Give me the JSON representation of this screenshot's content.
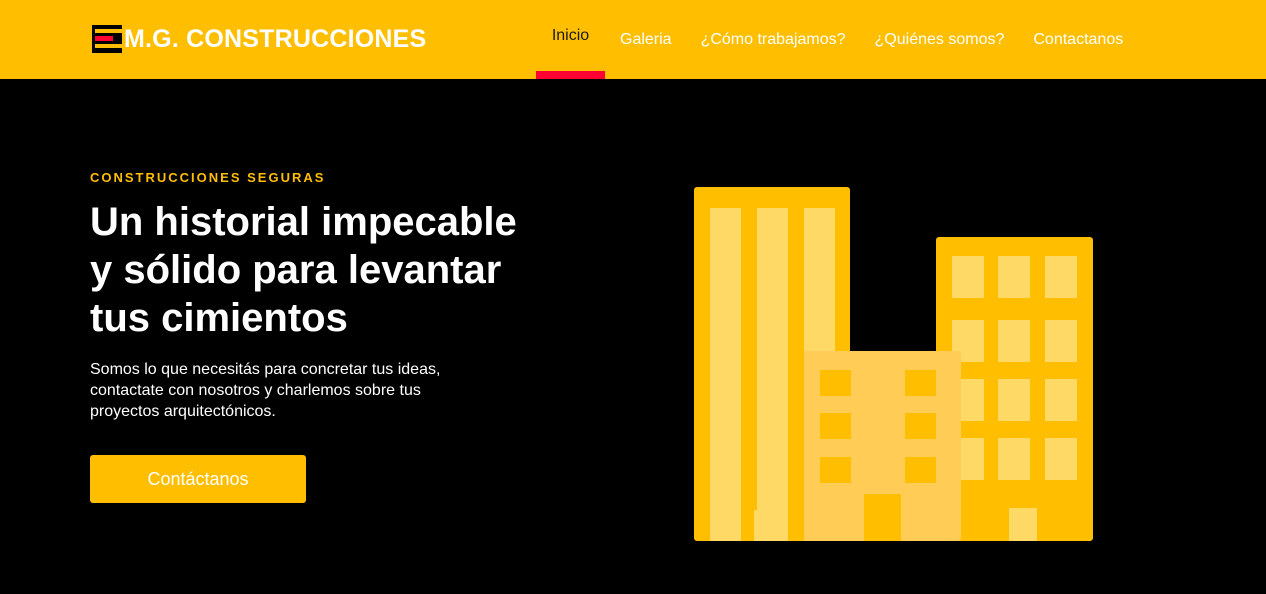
{
  "brand": {
    "name": "M.G. CONSTRUCCIONES",
    "logo_icon": "logo-stripes-icon",
    "colors": {
      "primary": "#ffbf00",
      "accent": "#ff0033",
      "background": "#000000"
    }
  },
  "nav": {
    "items": [
      {
        "label": "Inicio",
        "active": true
      },
      {
        "label": "Galeria",
        "active": false
      },
      {
        "label": "¿Cómo trabajamos?",
        "active": false
      },
      {
        "label": "¿Quiénes somos?",
        "active": false
      },
      {
        "label": "Contactanos",
        "active": false
      }
    ]
  },
  "hero": {
    "eyebrow": "CONSTRUCCIONES SEGURAS",
    "title_lines": [
      "Un historial impecable",
      "y sólido para levantar",
      "tus cimientos"
    ],
    "description_lines": [
      "Somos lo que necesitás para concretar tus ideas,",
      "contactate con nosotros y charlemos sobre tus",
      "proyectos arquitectónicos."
    ],
    "cta_label": "Contáctanos",
    "illustration_icon": "buildings-illustration"
  }
}
